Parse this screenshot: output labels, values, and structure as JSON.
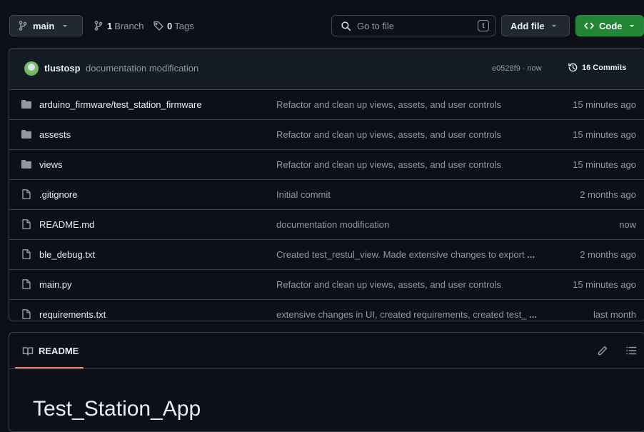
{
  "toolbar": {
    "branch_label": "main",
    "branch_count": "1",
    "branch_word": "Branch",
    "tag_count": "0",
    "tag_word": "Tags",
    "search_placeholder": "Go to file",
    "search_shortcut": "t",
    "add_file_label": "Add file",
    "code_label": "Code"
  },
  "latest_commit": {
    "author": "tlustosp",
    "message": "documentation modification",
    "sha_time": "e0528f9 · now",
    "commits_label": "16 Commits"
  },
  "files": [
    {
      "type": "folder",
      "name": "arduino_firmware/test_station_firmware",
      "message": "Refactor and clean up views, assets, and user controls",
      "time": "15 minutes ago"
    },
    {
      "type": "folder",
      "name": "assests",
      "message": "Refactor and clean up views, assets, and user controls",
      "time": "15 minutes ago"
    },
    {
      "type": "folder",
      "name": "views",
      "message": "Refactor and clean up views, assets, and user controls",
      "time": "15 minutes ago"
    },
    {
      "type": "file",
      "name": ".gitignore",
      "message": "Initial commit",
      "time": "2 months ago"
    },
    {
      "type": "file",
      "name": "README.md",
      "message": "documentation modification",
      "time": "now"
    },
    {
      "type": "file",
      "name": "ble_debug.txt",
      "message": "Created test_restul_view. Made extensive changes to export",
      "time": "2 months ago",
      "ellipsis": "..."
    },
    {
      "type": "file",
      "name": "main.py",
      "message": "Refactor and clean up views, assets, and user controls",
      "time": "15 minutes ago"
    },
    {
      "type": "file",
      "name": "requirements.txt",
      "message": "extensive changes in UI, created requirements, created test_",
      "time": "last month",
      "ellipsis": "..."
    }
  ],
  "readme": {
    "tab_label": "README",
    "title": "Test_Station_App"
  },
  "colors": {
    "background": "#0d1117",
    "code_button": "#238636",
    "tab_underline": "#f78166"
  }
}
